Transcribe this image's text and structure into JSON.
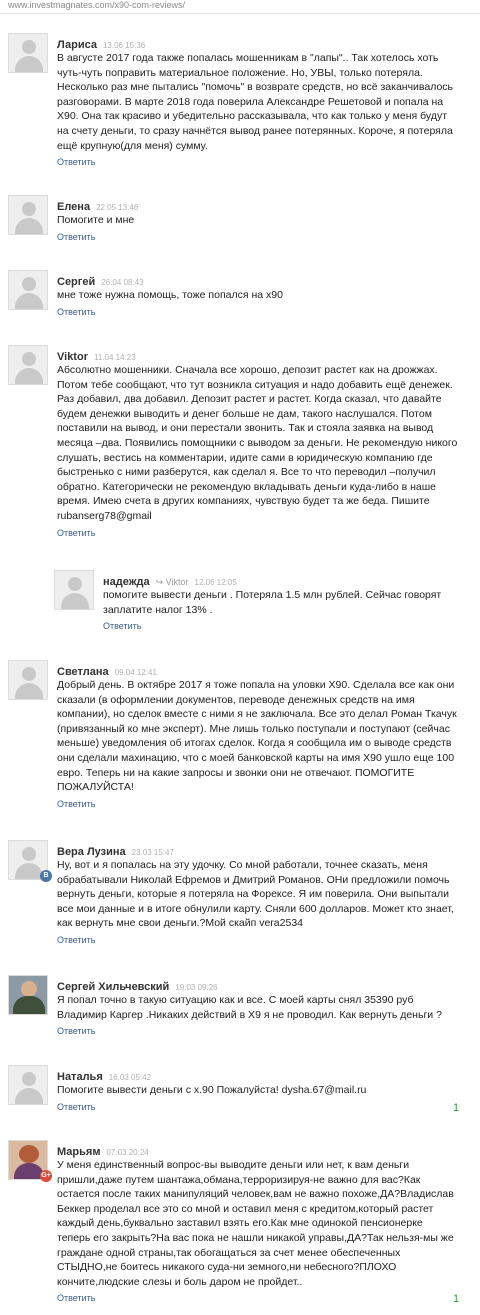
{
  "browser": {
    "url": "www.investmagnates.com/x90-com-reviews/"
  },
  "reply_label": "Ответить",
  "comments": [
    {
      "author": "Лариса",
      "date": "13.06 15:36",
      "lines": [
        "В августе 2017 года также попалась мошенникам в \"лапы\".. Так хотелось хоть",
        "чуть-чуть поправить материальное положение. Но, УВЫ, только потеряла.",
        "Несколько раз мне пытались \"помочь\" в возврате средств, но всё заканчивалось",
        "разговорами. В марте 2018 года поверила Александре Решетовой и попала на",
        "Х90. Она так красиво и убедительно рассказывала, что как только у меня будут",
        "на счету деньги, то сразу начнётся вывод ранее потерянных. Короче, я потеряла",
        "ещё крупную(для меня) сумму."
      ]
    },
    {
      "author": "Елена",
      "date": "22.05 13:46",
      "lines": [
        "Помогите и мне"
      ]
    },
    {
      "author": "Сергей",
      "date": "26.04 08:43",
      "lines": [
        "мне тоже нужна помощь, тоже попался на х90"
      ]
    },
    {
      "author": "Viktor",
      "date": "11.04 14:23",
      "lines": [
        "Абсолютно мошенники. Сначала все хорошо, депозит растет как на дрожжах.",
        "Потом тебе сообщают, что тут возникла ситуация и надо добавить ещё денежек.",
        "Раз добавил, два добавил. Депозит растет и растет. Когда сказал, что давайте",
        "будем денежки выводить и денег больше не дам, такого наслушался. Потом",
        "поставили на вывод, и они перестали звонить. Так и стояла заявка на вывод",
        "месяца –два. Появились помощники с выводом за деньги. Не рекомендую никого",
        "слушать, вестись на комментарии,  идите сами в юридическую компанию где",
        "быстренько с ними разберутся, как сделал я. Все то что переводил –получил",
        "обратно. Категорически не рекомендую вкладывать деньги куда-либо в наше",
        "время. Имею счета в других компаниях, чувствую будет та же беда. Пишите",
        "rubanserg78@gmail"
      ]
    },
    {
      "author": "надежда",
      "reply_to": "Viktor",
      "date": "12.06 12:05",
      "lines": [
        "помогите вывести деньги . Потеряла 1.5 млн рублей. Сейчас говорят",
        "заплатите налог 13% ."
      ]
    },
    {
      "author": "Светлана",
      "date": "09.04 12:41",
      "lines": [
        "Добрый день. В октябре 2017 я тоже попала на уловки Х90. Сделала все как они",
        "сказали (в оформлении документов, переводе денежных средств на имя",
        "компании), но сделок вместе с ними я не заключала. Все это делал Роман Ткачук",
        "(привязанный ко мне эксперт). Мне лишь только поступали и поступают (сейчас",
        "меньше) уведомления об итогах сделок. Когда я сообщила им о выводе средств",
        "они сделали махинацию, что с моей банковской карты на имя Х90 ушло еще 100",
        "евро. Теперь ни на какие запросы и звонки они не отвечают. ПОМОГИТЕ",
        "ПОЖАЛУЙСТА!"
      ]
    },
    {
      "author": "Вера Лузина",
      "date": "23.03 15:47",
      "badge": "B",
      "lines": [
        "Ну, вот и я попалась на эту удочку. Со мной работали, точнее сказать, меня",
        "обрабатывали Николай Ефремов и Дмитрий Романов. ОНи предложили помочь",
        "вернуть деньги, которые я потеряла на Форексе. Я им поверила. Они выпытали",
        "все мои данные и в итоге обнулили карту. Сняли 600 долларов. Может кто знает,",
        "как вернуть мне свои деньги.?Мой скайп vera2534"
      ]
    },
    {
      "author": "Сергей Хильчевский",
      "date": "19.03 09:26",
      "lines": [
        "Я попал точно в такую ситуацию как и все. С моей карты снял 35390 руб",
        "Владимир Каргер .Никаких действий в Х9 я не проводил. Как вернуть деньги ?"
      ]
    },
    {
      "author": "Наталья",
      "date": "16.03 05:42",
      "counter": "1",
      "lines": [
        "Помогите вывести деньги с х.90 Пожалуйста! dysha.67@mail.ru"
      ]
    },
    {
      "author": "Марьям",
      "date": "07.03 20:24",
      "badge": "G+",
      "counter": "1",
      "lines": [
        "У меня единственный вопрос-вы выводите деньги или нет, к вам деньги",
        "пришли,даже путем шантажа,обмана,терроризируя-не важно для вас?Как",
        "остается после таких манипуляций человек,вам не важно похоже,ДА?Владислав",
        "Беккер проделал все это со мной и оставил меня с кредитом,который растет",
        "каждый день,буквально заставил взять его.Как мне одинокой пенсионерке",
        "теперь его закрыть?На вас пока не нашли никакой  управы,ДА?Так нельзя-мы же",
        "граждане одной страны,так обогащаться за счет менее обеспеченных",
        "СТЫДНО,не боитесь никакого суда-ни земного,ни небесного?ПЛОХО",
        "кончите,людские слезы и боль даром не пройдет.."
      ]
    }
  ]
}
